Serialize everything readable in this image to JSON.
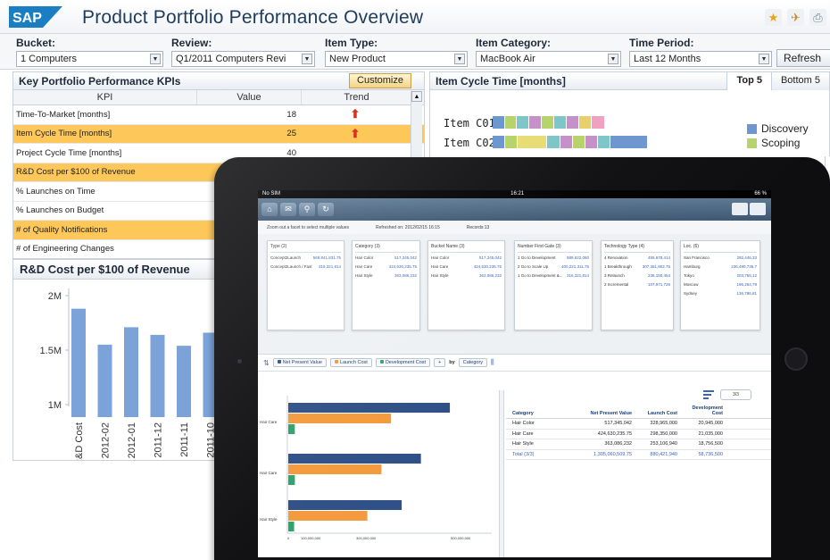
{
  "header": {
    "logo_text": "SAP",
    "title": "Product Portfolio Performance Overview",
    "icons": [
      "star-icon",
      "pin-icon",
      "print-icon"
    ]
  },
  "filters": {
    "bucket": {
      "label": "Bucket:",
      "value": "1 Computers"
    },
    "review": {
      "label": "Review:",
      "value": "Q1/2011 Computers Revi"
    },
    "item_type": {
      "label": "Item Type:",
      "value": "New Product"
    },
    "item_category": {
      "label": "Item Category:",
      "value": "MacBook Air"
    },
    "time_period": {
      "label": "Time Period:",
      "value": "Last 12 Months"
    },
    "refresh_label": "Refresh"
  },
  "kpi_panel": {
    "title": "Key Portfolio Performance KPIs",
    "customize_label": "Customize",
    "columns": [
      "KPI",
      "Value",
      "Trend"
    ],
    "rows": [
      {
        "kpi": "Time-To-Market [months]",
        "value": "18",
        "trend": "up",
        "highlight": false
      },
      {
        "kpi": "Item Cycle Time [months]",
        "value": "25",
        "trend": "up",
        "highlight": true
      },
      {
        "kpi": "Project Cycle Time [months]",
        "value": "40",
        "trend": "",
        "highlight": false
      },
      {
        "kpi": "R&D Cost per $100 of Revenue",
        "value": "",
        "trend": "",
        "highlight": true
      },
      {
        "kpi": "% Launches on Time",
        "value": "",
        "trend": "",
        "highlight": false
      },
      {
        "kpi": "% Launches on Budget",
        "value": "",
        "trend": "",
        "highlight": false
      },
      {
        "kpi": "# of Quality Notifications",
        "value": "",
        "trend": "",
        "highlight": true
      },
      {
        "kpi": "# of Engineering Changes",
        "value": "",
        "trend": "",
        "highlight": false
      }
    ],
    "highlight_color": "#fdc75a",
    "trend_color": "#d9301f"
  },
  "cycle_panel": {
    "title": "Item Cycle Time [months]",
    "tabs": [
      "Top 5",
      "Bottom 5"
    ],
    "items": [
      "Item C01",
      "Item C02"
    ],
    "legend": [
      {
        "name": "Discovery",
        "color": "#6f97cf"
      },
      {
        "name": "Scoping",
        "color": "#b7d36b"
      }
    ]
  },
  "rd_panel": {
    "title": "R&D Cost per $100 of Revenue"
  },
  "chart_data": {
    "type": "bar",
    "ylim": [
      1000000,
      2000000
    ],
    "yticks": [
      "2M",
      "1.5M",
      "1M"
    ],
    "categories": [
      "Total R&D Cost",
      "2012-02",
      "2012-01",
      "2011-12",
      "2011-11",
      "2011-10"
    ],
    "values": [
      1880000,
      1550000,
      1710000,
      1640000,
      1540000,
      1660000
    ],
    "bar_color": "#7ba3d9"
  },
  "ipad": {
    "status": {
      "carrier": "No SIM",
      "time": "16:21",
      "battery": "66 %"
    },
    "info": {
      "hint": "Zoom out a facet to select multiple values",
      "refreshed": "Refreshed on: 2012/02/15 16:15",
      "records": "Records:13"
    },
    "facets": [
      {
        "title": "Type (2)",
        "lines": [
          [
            "Concept2Launch",
            "569,841,831.75"
          ],
          [
            "Concept2Launch / Fast",
            "316,321,814"
          ]
        ]
      },
      {
        "title": "Category (3)",
        "lines": [
          [
            "Hair Color",
            "517,345,042"
          ],
          [
            "Hair Care",
            "424,630,235.75"
          ],
          [
            "Hair Style",
            "363,086,232"
          ]
        ]
      },
      {
        "title": "Bucket Name (3)",
        "lines": [
          [
            "Hair Color",
            "517,345,042"
          ],
          [
            "Hair Care",
            "424,630,235.75"
          ],
          [
            "Hair Style",
            "363,086,232"
          ]
        ]
      },
      {
        "title": "Number First Gate (3)",
        "lines": [
          [
            "1 Go to Development",
            "589,622,060"
          ],
          [
            "2 Go to Scale Up",
            "400,221,311.75"
          ],
          [
            "1 Go to Development &...",
            "316,321,814"
          ]
        ]
      },
      {
        "title": "Technology Type (4)",
        "lines": [
          [
            "4 Renovation",
            "455,678,414"
          ],
          [
            "1 Breakthrough",
            "307,361,902.75"
          ],
          [
            "3 Relaunch",
            "236,150,454"
          ],
          [
            "2 Incremental",
            "107,971,726"
          ]
        ]
      },
      {
        "title": "Loc. (6)",
        "lines": [
          [
            "San Francisco",
            "292,446,33"
          ],
          [
            "Hamburg",
            "236,490,735.7"
          ],
          [
            "Tokyo",
            "203,765,12"
          ],
          [
            "Moscow",
            "196,264,79"
          ],
          [
            "Sydney",
            "136,786,81"
          ]
        ]
      }
    ],
    "toolbar": {
      "measures": [
        {
          "name": "Net Present Value",
          "color": "#2e4f86"
        },
        {
          "name": "Launch Cost",
          "color": "#f39a3c"
        },
        {
          "name": "Development Cost",
          "color": "#2ea36b"
        }
      ],
      "plus": "+",
      "by_label": "by",
      "dimension": "Category",
      "pager": "3/3"
    },
    "chart": {
      "categories": [
        "Hair Care",
        "Hair Care",
        "Hair Style"
      ],
      "npv": [
        517345042,
        424630235.75,
        363086232
      ],
      "launch": [
        328965000,
        298350000,
        253106940
      ],
      "dev": [
        20945000,
        21035000,
        18756500
      ],
      "x_ticks": [
        "0",
        "100,000,000",
        "300,000,000",
        "500,000,000"
      ]
    },
    "table": {
      "columns": [
        "Category",
        "Net Present Value",
        "Launch Cost",
        "Development Cost"
      ],
      "rows": [
        [
          "Hair Color",
          "517,345,042",
          "328,965,000",
          "20,945,000"
        ],
        [
          "Hair Care",
          "424,630,235.75",
          "298,350,000",
          "21,035,000"
        ],
        [
          "Hair Style",
          "363,086,232",
          "253,106,940",
          "18,756,500"
        ],
        [
          "Total (3/3)",
          "1,305,060,509.75",
          "880,421,940",
          "58,736,500"
        ]
      ]
    }
  }
}
